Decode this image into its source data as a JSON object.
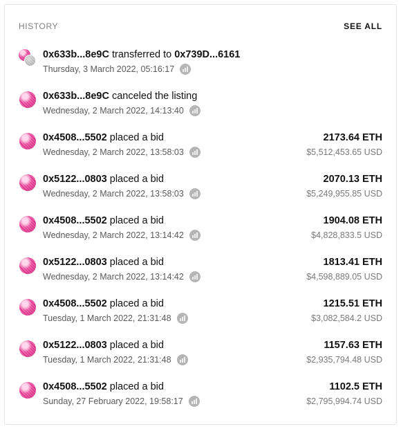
{
  "header": {
    "title": "HISTORY",
    "see_all": "SEE ALL"
  },
  "events": [
    {
      "from": "0x633b...8e9C",
      "action": " transferred to ",
      "to": "0x739D...6161",
      "date": "Thursday, 3 March 2022, 05:16:17",
      "eth": "",
      "usd": "",
      "avatar": "pair"
    },
    {
      "from": "0x633b...8e9C",
      "action": " canceled the listing",
      "to": "",
      "date": "Wednesday, 2 March 2022, 14:13:40",
      "eth": "",
      "usd": "",
      "avatar": "single"
    },
    {
      "from": "0x4508...5502",
      "action": " placed a bid",
      "to": "",
      "date": "Wednesday, 2 March 2022, 13:58:03",
      "eth": "2173.64 ETH",
      "usd": "$5,512,453.65 USD",
      "avatar": "single"
    },
    {
      "from": "0x5122...0803",
      "action": " placed a bid",
      "to": "",
      "date": "Wednesday, 2 March 2022, 13:58:03",
      "eth": "2070.13 ETH",
      "usd": "$5,249,955.85 USD",
      "avatar": "single"
    },
    {
      "from": "0x4508...5502",
      "action": " placed a bid",
      "to": "",
      "date": "Wednesday, 2 March 2022, 13:14:42",
      "eth": "1904.08 ETH",
      "usd": "$4,828,833.5 USD",
      "avatar": "single"
    },
    {
      "from": "0x5122...0803",
      "action": " placed a bid",
      "to": "",
      "date": "Wednesday, 2 March 2022, 13:14:42",
      "eth": "1813.41 ETH",
      "usd": "$4,598,889.05 USD",
      "avatar": "single"
    },
    {
      "from": "0x4508...5502",
      "action": " placed a bid",
      "to": "",
      "date": "Tuesday, 1 March 2022, 21:31:48",
      "eth": "1215.51 ETH",
      "usd": "$3,082,584.2 USD",
      "avatar": "single"
    },
    {
      "from": "0x5122...0803",
      "action": " placed a bid",
      "to": "",
      "date": "Tuesday, 1 March 2022, 21:31:48",
      "eth": "1157.63 ETH",
      "usd": "$2,935,794.48 USD",
      "avatar": "single"
    },
    {
      "from": "0x4508...5502",
      "action": " placed a bid",
      "to": "",
      "date": "Sunday, 27 February 2022, 19:58:17",
      "eth": "1102.5 ETH",
      "usd": "$2,795,994.74 USD",
      "avatar": "single"
    }
  ],
  "icons": {
    "external": "etherscan-link-icon"
  },
  "colors": {
    "avatar_pink": "#e0358e",
    "muted_text": "#808080",
    "icon_grey": "#b5b5b5"
  }
}
